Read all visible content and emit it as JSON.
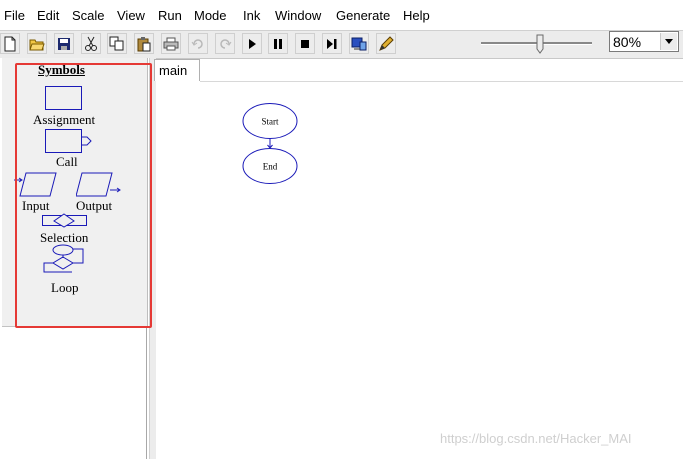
{
  "menu": {
    "file": "File",
    "edit": "Edit",
    "scale": "Scale",
    "view": "View",
    "run": "Run",
    "mode": "Mode",
    "ink": "Ink",
    "window": "Window",
    "generate": "Generate",
    "help": "Help"
  },
  "toolbar": {
    "zoom_value": "80%"
  },
  "symbols": {
    "title": "Symbols",
    "assignment": "Assignment",
    "call": "Call",
    "input": "Input",
    "output": "Output",
    "selection": "Selection",
    "loop": "Loop"
  },
  "tabs": {
    "main": "main"
  },
  "flowchart": {
    "start": "Start",
    "end": "End"
  },
  "colors": {
    "symbol_stroke": "#1a1ab8",
    "highlight": "#e53935",
    "watermark": "#cfcfcf"
  },
  "watermark": "https://blog.csdn.net/Hacker_MAI"
}
